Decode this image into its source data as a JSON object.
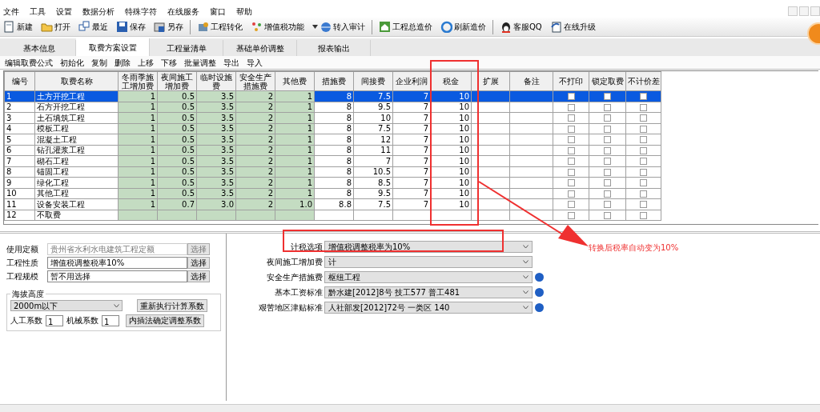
{
  "menu": [
    "文件",
    "工具",
    "设置",
    "数据分析",
    "特殊字符",
    "在线服务",
    "窗口",
    "帮助"
  ],
  "toolbar": [
    {
      "kind": "button",
      "label": "新建"
    },
    {
      "kind": "button",
      "label": "打开"
    },
    {
      "kind": "button",
      "label": "最近"
    },
    {
      "kind": "button",
      "label": "保存"
    },
    {
      "kind": "button",
      "label": "另存"
    },
    {
      "kind": "separator"
    },
    {
      "kind": "button",
      "label": "工程转化"
    },
    {
      "kind": "button",
      "label": "增值税功能"
    },
    {
      "kind": "dropdown",
      "label": "转入审计"
    },
    {
      "kind": "separator"
    },
    {
      "kind": "button",
      "label": "工程总造价"
    },
    {
      "kind": "button",
      "label": "刷新造价"
    },
    {
      "kind": "separator"
    },
    {
      "kind": "button",
      "label": "客服QQ"
    },
    {
      "kind": "button",
      "label": "在线升级"
    }
  ],
  "tabs": [
    {
      "label": "基本信息",
      "selected": false
    },
    {
      "label": "取费方案设置",
      "selected": true
    },
    {
      "label": "工程量清单",
      "selected": false
    },
    {
      "label": "基础单价调整",
      "selected": false
    },
    {
      "label": "报表输出",
      "selected": false
    }
  ],
  "table_toolbar": [
    "编辑取费公式",
    "初始化",
    "复制",
    "删除",
    "上移",
    "下移",
    "批量调整",
    "导出",
    "导入"
  ],
  "table": {
    "columns": [
      "编号",
      "取费名称",
      "冬雨季施工增加费",
      "夜间施工增加费",
      "临时设施费",
      "安全生产措施费",
      "其他费",
      "措施费",
      "间接费",
      "企业利润",
      "税金",
      "扩展",
      "备注",
      "不打印",
      "锁定取费",
      "不计价差"
    ],
    "rows": [
      {
        "no": "1",
        "name": "土方开挖工程",
        "values": [
          "1",
          "0.5",
          "3.5",
          "2",
          "1",
          "8",
          "7.5",
          "7",
          "10"
        ],
        "selected": true,
        "no_print": false,
        "lock_fee": false,
        "no_price_diff": false
      },
      {
        "no": "2",
        "name": "石方开挖工程",
        "values": [
          "1",
          "0.5",
          "3.5",
          "2",
          "1",
          "8",
          "9.5",
          "7",
          "10"
        ],
        "selected": false,
        "no_print": false,
        "lock_fee": false,
        "no_price_diff": false
      },
      {
        "no": "3",
        "name": "土石填筑工程",
        "values": [
          "1",
          "0.5",
          "3.5",
          "2",
          "1",
          "8",
          "10",
          "7",
          "10"
        ],
        "selected": false,
        "no_print": false,
        "lock_fee": false,
        "no_price_diff": false
      },
      {
        "no": "4",
        "name": "模板工程",
        "values": [
          "1",
          "0.5",
          "3.5",
          "2",
          "1",
          "8",
          "7.5",
          "7",
          "10"
        ],
        "selected": false,
        "no_print": false,
        "lock_fee": false,
        "no_price_diff": false
      },
      {
        "no": "5",
        "name": "混凝土工程",
        "values": [
          "1",
          "0.5",
          "3.5",
          "2",
          "1",
          "8",
          "12",
          "7",
          "10"
        ],
        "selected": false,
        "no_print": false,
        "lock_fee": false,
        "no_price_diff": false
      },
      {
        "no": "6",
        "name": "钻孔灌浆工程",
        "values": [
          "1",
          "0.5",
          "3.5",
          "2",
          "1",
          "8",
          "11",
          "7",
          "10"
        ],
        "selected": false,
        "no_print": false,
        "lock_fee": false,
        "no_price_diff": false
      },
      {
        "no": "7",
        "name": "砌石工程",
        "values": [
          "1",
          "0.5",
          "3.5",
          "2",
          "1",
          "8",
          "7",
          "7",
          "10"
        ],
        "selected": false,
        "no_print": false,
        "lock_fee": false,
        "no_price_diff": false
      },
      {
        "no": "8",
        "name": "锚固工程",
        "values": [
          "1",
          "0.5",
          "3.5",
          "2",
          "1",
          "8",
          "10.5",
          "7",
          "10"
        ],
        "selected": false,
        "no_print": false,
        "lock_fee": false,
        "no_price_diff": false
      },
      {
        "no": "9",
        "name": "绿化工程",
        "values": [
          "1",
          "0.5",
          "3.5",
          "2",
          "1",
          "8",
          "8.5",
          "7",
          "10"
        ],
        "selected": false,
        "no_print": false,
        "lock_fee": false,
        "no_price_diff": false
      },
      {
        "no": "10",
        "name": "其他工程",
        "values": [
          "1",
          "0.5",
          "3.5",
          "2",
          "1",
          "8",
          "9.5",
          "7",
          "10"
        ],
        "selected": false,
        "no_print": false,
        "lock_fee": false,
        "no_price_diff": false
      },
      {
        "no": "11",
        "name": "设备安装工程",
        "values": [
          "1",
          "0.7",
          "3.0",
          "2",
          "1.0",
          "8.8",
          "7.5",
          "7",
          "10"
        ],
        "selected": false,
        "no_print": false,
        "lock_fee": false,
        "no_price_diff": false
      },
      {
        "no": "12",
        "name": "不取费",
        "selected": false,
        "no_print": false,
        "lock_fee": false,
        "no_price_diff": false
      }
    ]
  },
  "left_panel": {
    "fields": [
      {
        "label": "使用定额",
        "value": "贵州省水利水电建筑工程定额",
        "button": "选择",
        "disabled": true
      },
      {
        "label": "工程性质",
        "value": "增值税调整税率10%",
        "button": "选择",
        "disabled": false
      },
      {
        "label": "工程规模",
        "value": "暂不用选择",
        "button": "选择",
        "disabled": false
      }
    ],
    "altitude": {
      "title": "海拔高度",
      "select": "2000m以下",
      "recalc_button": "重新执行计算系数",
      "labor_label": "人工系数",
      "labor_value": "1",
      "machine_label": "机械系数",
      "machine_value": "1",
      "interp_button": "内插法确定调整系数"
    }
  },
  "right_panel": {
    "options": [
      {
        "label": "计税选项",
        "value": "增值税调整税率为10%",
        "help": false
      },
      {
        "label": "夜间施工增加费",
        "value": "计",
        "help": false
      },
      {
        "label": "安全生产措施费",
        "value": "枢纽工程",
        "help": true
      },
      {
        "label": "基本工资标准",
        "value": "黔水建[2012]8号 技工577 普工481",
        "help": true
      },
      {
        "label": "艰苦地区津贴标准",
        "value": "人社部发[2012]72号 一类区 140",
        "help": true
      }
    ]
  },
  "annotation": {
    "text": "转换后税率自动变为10%"
  }
}
